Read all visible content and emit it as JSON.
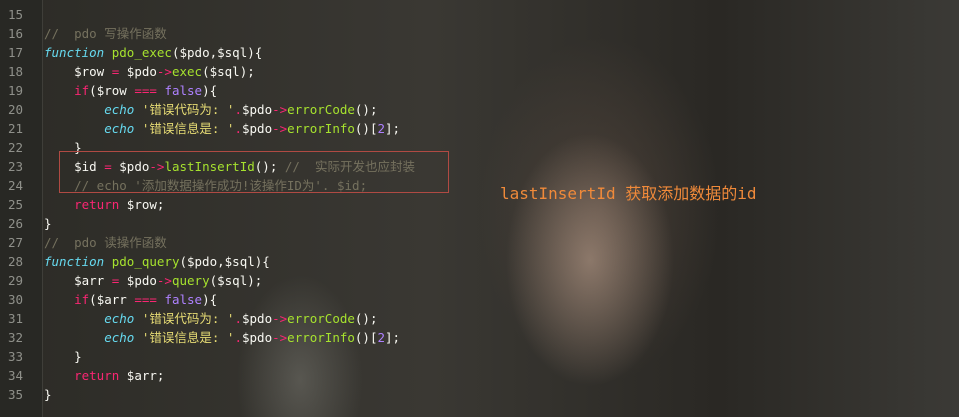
{
  "editor": {
    "lines": [
      {
        "num": "15",
        "tokens": []
      },
      {
        "num": "16",
        "tokens": [
          {
            "c": "comment",
            "t": "//  pdo 写操作函数"
          }
        ]
      },
      {
        "num": "17",
        "tokens": [
          {
            "c": "kw",
            "t": "function"
          },
          {
            "c": "plain",
            "t": " "
          },
          {
            "c": "fn",
            "t": "pdo_exec"
          },
          {
            "c": "plain",
            "t": "($pdo,$sql){"
          }
        ]
      },
      {
        "num": "18",
        "tokens": [
          {
            "c": "plain",
            "t": "    $row "
          },
          {
            "c": "op",
            "t": "="
          },
          {
            "c": "plain",
            "t": " $pdo"
          },
          {
            "c": "op",
            "t": "->"
          },
          {
            "c": "fn",
            "t": "exec"
          },
          {
            "c": "plain",
            "t": "($sql);"
          }
        ]
      },
      {
        "num": "19",
        "tokens": [
          {
            "c": "plain",
            "t": "    "
          },
          {
            "c": "op",
            "t": "if"
          },
          {
            "c": "plain",
            "t": "($row "
          },
          {
            "c": "op",
            "t": "==="
          },
          {
            "c": "plain",
            "t": " "
          },
          {
            "c": "num",
            "t": "false"
          },
          {
            "c": "plain",
            "t": "){"
          }
        ]
      },
      {
        "num": "20",
        "tokens": [
          {
            "c": "plain",
            "t": "        "
          },
          {
            "c": "kw",
            "t": "echo"
          },
          {
            "c": "plain",
            "t": " "
          },
          {
            "c": "str",
            "t": "'错误代码为: '"
          },
          {
            "c": "op",
            "t": "."
          },
          {
            "c": "plain",
            "t": "$pdo"
          },
          {
            "c": "op",
            "t": "->"
          },
          {
            "c": "fn",
            "t": "errorCode"
          },
          {
            "c": "plain",
            "t": "();"
          }
        ]
      },
      {
        "num": "21",
        "tokens": [
          {
            "c": "plain",
            "t": "        "
          },
          {
            "c": "kw",
            "t": "echo"
          },
          {
            "c": "plain",
            "t": " "
          },
          {
            "c": "str",
            "t": "'错误信息是: '"
          },
          {
            "c": "op",
            "t": "."
          },
          {
            "c": "plain",
            "t": "$pdo"
          },
          {
            "c": "op",
            "t": "->"
          },
          {
            "c": "fn",
            "t": "errorInfo"
          },
          {
            "c": "plain",
            "t": "()["
          },
          {
            "c": "num",
            "t": "2"
          },
          {
            "c": "plain",
            "t": "];"
          }
        ]
      },
      {
        "num": "22",
        "tokens": [
          {
            "c": "plain",
            "t": "    }"
          }
        ]
      },
      {
        "num": "23",
        "tokens": [
          {
            "c": "plain",
            "t": "    $id "
          },
          {
            "c": "op",
            "t": "="
          },
          {
            "c": "plain",
            "t": " $pdo"
          },
          {
            "c": "op",
            "t": "->"
          },
          {
            "c": "fn",
            "t": "lastInsertId"
          },
          {
            "c": "plain",
            "t": "(); "
          },
          {
            "c": "comment",
            "t": "//  实际开发也应封装"
          }
        ]
      },
      {
        "num": "24",
        "tokens": [
          {
            "c": "comment",
            "t": "    // echo '添加数据操作成功!该操作ID为'. $id;"
          }
        ]
      },
      {
        "num": "25",
        "tokens": [
          {
            "c": "plain",
            "t": "    "
          },
          {
            "c": "op",
            "t": "return"
          },
          {
            "c": "plain",
            "t": " $row;"
          }
        ]
      },
      {
        "num": "26",
        "tokens": [
          {
            "c": "plain",
            "t": "}"
          }
        ]
      },
      {
        "num": "27",
        "tokens": [
          {
            "c": "comment",
            "t": "//  pdo 读操作函数"
          }
        ]
      },
      {
        "num": "28",
        "tokens": [
          {
            "c": "kw",
            "t": "function"
          },
          {
            "c": "plain",
            "t": " "
          },
          {
            "c": "fn",
            "t": "pdo_query"
          },
          {
            "c": "plain",
            "t": "($pdo,$sql){"
          }
        ]
      },
      {
        "num": "29",
        "tokens": [
          {
            "c": "plain",
            "t": "    $arr "
          },
          {
            "c": "op",
            "t": "="
          },
          {
            "c": "plain",
            "t": " $pdo"
          },
          {
            "c": "op",
            "t": "->"
          },
          {
            "c": "fn",
            "t": "query"
          },
          {
            "c": "plain",
            "t": "($sql);"
          }
        ]
      },
      {
        "num": "30",
        "tokens": [
          {
            "c": "plain",
            "t": "    "
          },
          {
            "c": "op",
            "t": "if"
          },
          {
            "c": "plain",
            "t": "($arr "
          },
          {
            "c": "op",
            "t": "==="
          },
          {
            "c": "plain",
            "t": " "
          },
          {
            "c": "num",
            "t": "false"
          },
          {
            "c": "plain",
            "t": "){"
          }
        ]
      },
      {
        "num": "31",
        "tokens": [
          {
            "c": "plain",
            "t": "        "
          },
          {
            "c": "kw",
            "t": "echo"
          },
          {
            "c": "plain",
            "t": " "
          },
          {
            "c": "str",
            "t": "'错误代码为: '"
          },
          {
            "c": "op",
            "t": "."
          },
          {
            "c": "plain",
            "t": "$pdo"
          },
          {
            "c": "op",
            "t": "->"
          },
          {
            "c": "fn",
            "t": "errorCode"
          },
          {
            "c": "plain",
            "t": "();"
          }
        ]
      },
      {
        "num": "32",
        "tokens": [
          {
            "c": "plain",
            "t": "        "
          },
          {
            "c": "kw",
            "t": "echo"
          },
          {
            "c": "plain",
            "t": " "
          },
          {
            "c": "str",
            "t": "'错误信息是: '"
          },
          {
            "c": "op",
            "t": "."
          },
          {
            "c": "plain",
            "t": "$pdo"
          },
          {
            "c": "op",
            "t": "->"
          },
          {
            "c": "fn",
            "t": "errorInfo"
          },
          {
            "c": "plain",
            "t": "()["
          },
          {
            "c": "num",
            "t": "2"
          },
          {
            "c": "plain",
            "t": "];"
          }
        ]
      },
      {
        "num": "33",
        "tokens": [
          {
            "c": "plain",
            "t": "    }"
          }
        ]
      },
      {
        "num": "34",
        "tokens": [
          {
            "c": "plain",
            "t": "    "
          },
          {
            "c": "op",
            "t": "return"
          },
          {
            "c": "plain",
            "t": " $arr;"
          }
        ]
      },
      {
        "num": "35",
        "tokens": [
          {
            "c": "plain",
            "t": "}"
          }
        ]
      }
    ]
  },
  "annotation": {
    "text": "lastInsertId 获取添加数据的id",
    "color": "#f08a3a"
  },
  "theme": {
    "comment": "#75715e",
    "keyword": "#66d9ef",
    "function": "#a6e22e",
    "operator": "#f92672",
    "string": "#e6db74",
    "number": "#ae81ff",
    "highlight_border": "#b04a43"
  }
}
